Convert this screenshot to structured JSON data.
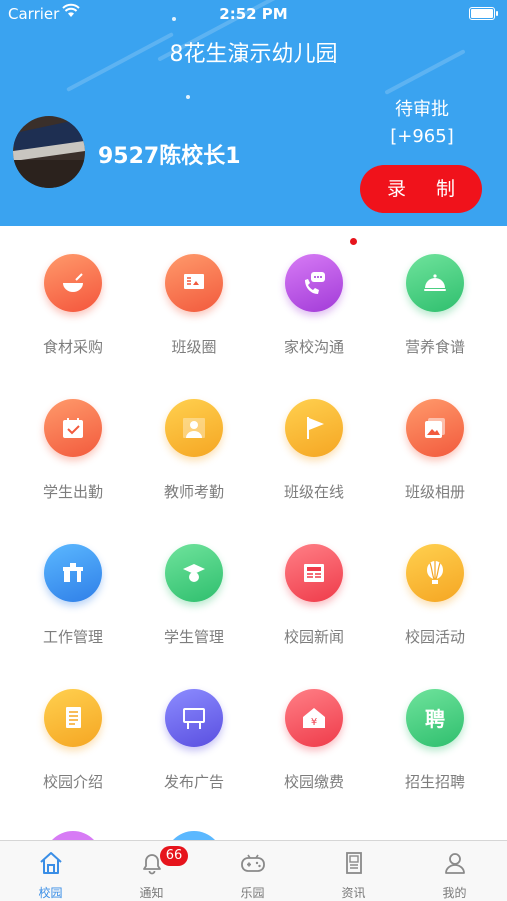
{
  "status_bar": {
    "carrier": "Carrier",
    "time": "2:52 PM"
  },
  "header": {
    "title": "8花生演示幼儿园",
    "username": "9527陈校长1",
    "pending_label": "待审批",
    "pending_count": "[+965]",
    "record_button": "录 制"
  },
  "grid": {
    "items": [
      {
        "label": "食材采购",
        "icon": "food-bowl-icon",
        "color_a": "#ff9a6b",
        "color_b": "#f4553c"
      },
      {
        "label": "班级圈",
        "icon": "class-board-icon",
        "color_a": "#ff9a6b",
        "color_b": "#f25a3d"
      },
      {
        "label": "家校沟通",
        "icon": "phone-chat-icon",
        "color_a": "#d77bf5",
        "color_b": "#a23bd8"
      },
      {
        "label": "营养食谱",
        "icon": "food-cloche-icon",
        "color_a": "#6fe39c",
        "color_b": "#2fbf6e"
      },
      {
        "label": "学生出勤",
        "icon": "calendar-check-icon",
        "color_a": "#ff9a6b",
        "color_b": "#f25a3d"
      },
      {
        "label": "教师考勤",
        "icon": "teacher-icon",
        "color_a": "#ffd04f",
        "color_b": "#f5a623"
      },
      {
        "label": "班级在线",
        "icon": "flag-icon",
        "color_a": "#ffd04f",
        "color_b": "#f5a623"
      },
      {
        "label": "班级相册",
        "icon": "photo-album-icon",
        "color_a": "#ff9a6b",
        "color_b": "#f25a3d"
      },
      {
        "label": "工作管理",
        "icon": "desk-icon",
        "color_a": "#5bb8ff",
        "color_b": "#2f7fe8"
      },
      {
        "label": "学生管理",
        "icon": "student-cap-icon",
        "color_a": "#6fe39c",
        "color_b": "#2fbf6e"
      },
      {
        "label": "校园新闻",
        "icon": "newspaper-icon",
        "color_a": "#ff7f86",
        "color_b": "#ef3b4a"
      },
      {
        "label": "校园活动",
        "icon": "balloon-icon",
        "color_a": "#ffd04f",
        "color_b": "#f5a623"
      },
      {
        "label": "校园介绍",
        "icon": "document-icon",
        "color_a": "#ffd04f",
        "color_b": "#f5a623"
      },
      {
        "label": "发布广告",
        "icon": "billboard-icon",
        "color_a": "#8c8cff",
        "color_b": "#5a4fe0"
      },
      {
        "label": "校园缴费",
        "icon": "payment-house-icon",
        "color_a": "#ff7f86",
        "color_b": "#ef3b4a"
      },
      {
        "label": "招生招聘",
        "icon": "recruit-icon",
        "color_a": "#6fe39c",
        "color_b": "#2fbf6e"
      }
    ]
  },
  "tabbar": {
    "tabs": [
      {
        "label": "校园",
        "icon": "home-icon",
        "active": true
      },
      {
        "label": "通知",
        "icon": "bell-icon",
        "badge": "66"
      },
      {
        "label": "乐园",
        "icon": "gamepad-icon"
      },
      {
        "label": "资讯",
        "icon": "news-icon"
      },
      {
        "label": "我的",
        "icon": "user-icon"
      }
    ]
  },
  "colors": {
    "header_bg": "#3aa3f0",
    "record_button": "#f0121b",
    "tab_active": "#3a8ee6"
  }
}
